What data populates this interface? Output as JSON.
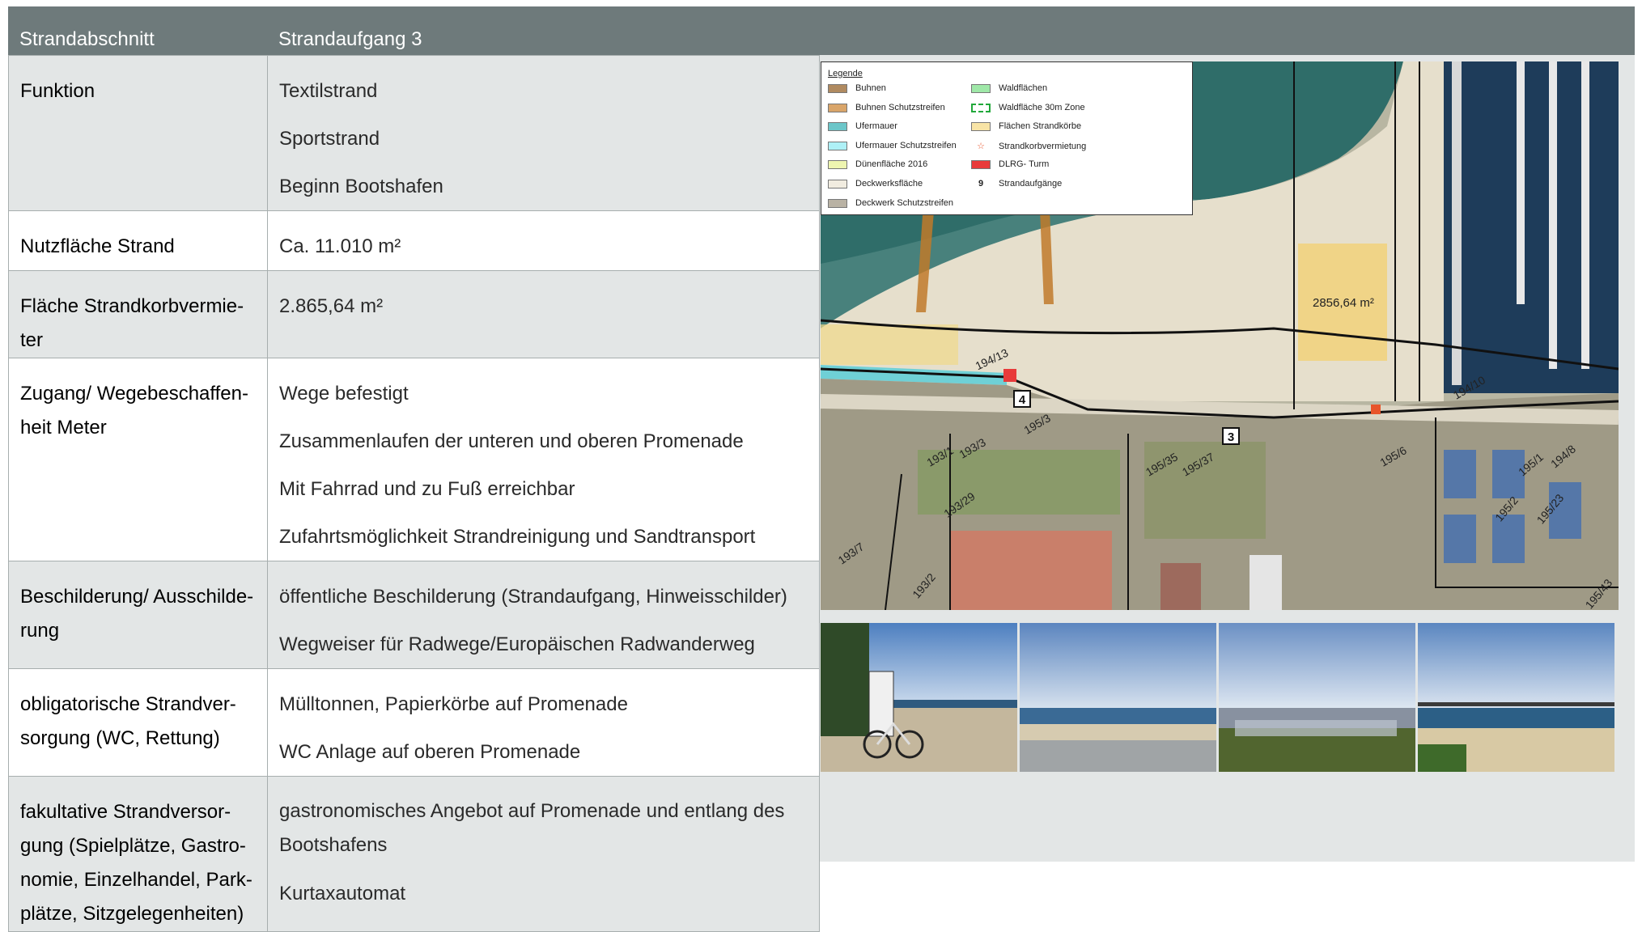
{
  "header": {
    "col1": "Strandabschnitt",
    "col2": "Strandaufgang 3"
  },
  "rows": [
    {
      "label": "Funktion",
      "values": [
        "Textilstrand",
        "Sportstrand",
        "Beginn Bootshafen"
      ]
    },
    {
      "label": "Nutzfläche Strand",
      "values": [
        "Ca. 11.010 m²"
      ]
    },
    {
      "label": "Fläche Strandkorbvermie-ter",
      "values": [
        "2.865,64 m²"
      ]
    },
    {
      "label": "Zugang/ Wegebeschaffen-heit Meter",
      "values": [
        "Wege befestigt",
        "Zusammenlaufen der unteren und oberen Promenade",
        "Mit Fahrrad und zu Fuß erreichbar",
        "Zufahrtsmöglichkeit Strandreinigung und Sandtransport"
      ]
    },
    {
      "label": "Beschilderung/ Ausschilde-rung",
      "values": [
        "öffentliche Beschilderung (Strandaufgang, Hinweisschilder)",
        "Wegweiser für Radwege/Europäischen Radwanderweg"
      ]
    },
    {
      "label": "obligatorische Strandver-sorgung (WC, Rettung)",
      "values": [
        "Mülltonnen, Papierkörbe auf Promenade",
        "WC Anlage auf oberen Promenade"
      ]
    },
    {
      "label": "fakultative Strandversor-gung (Spielplätze, Gastro-nomie, Einzelhandel, Park-plätze, Sitzgelegenheiten)",
      "values": [
        "gastronomisches Angebot auf Promenade und entlang des Bootshafens",
        "Kurtaxautomat"
      ]
    }
  ],
  "map": {
    "legend_title": "Legende",
    "legend_left": [
      "Buhnen",
      "Buhnen Schutzstreifen",
      "Ufermauer",
      "Ufermauer Schutzstreifen",
      "Dünenfläche 2016",
      "Deckwerksfläche",
      "Deckwerk Schutzstreifen"
    ],
    "legend_right": [
      "Waldflächen",
      "Waldfläche 30m Zone",
      "Flächen Strandkörbe",
      "Strandkorbvermietung",
      "DLRG- Turm",
      "Strandaufgänge"
    ],
    "legend_colors_left": [
      "#b08a60",
      "#d9a56a",
      "#6cc6c9",
      "#aef0f6",
      "#eef5b0",
      "#f1ece0",
      "#b9b2a4"
    ],
    "legend_colors_right": [
      "#9fe8a8",
      "#ffffff",
      "#f8e4a6"
    ],
    "area_label": "2856,64 m²",
    "access_numbers": [
      "4",
      "3"
    ],
    "legend_symbol_nine": "9",
    "parcel_labels": [
      "194/13",
      "194/10",
      "193/1",
      "193/29",
      "193/7",
      "195/35",
      "195/37",
      "195/2",
      "195/23",
      "195/43",
      "194/8",
      "195/1",
      "193/3",
      "193/2",
      "195/3",
      "195/6"
    ]
  },
  "photos": [
    "photo-1",
    "photo-2",
    "photo-3",
    "photo-4"
  ]
}
